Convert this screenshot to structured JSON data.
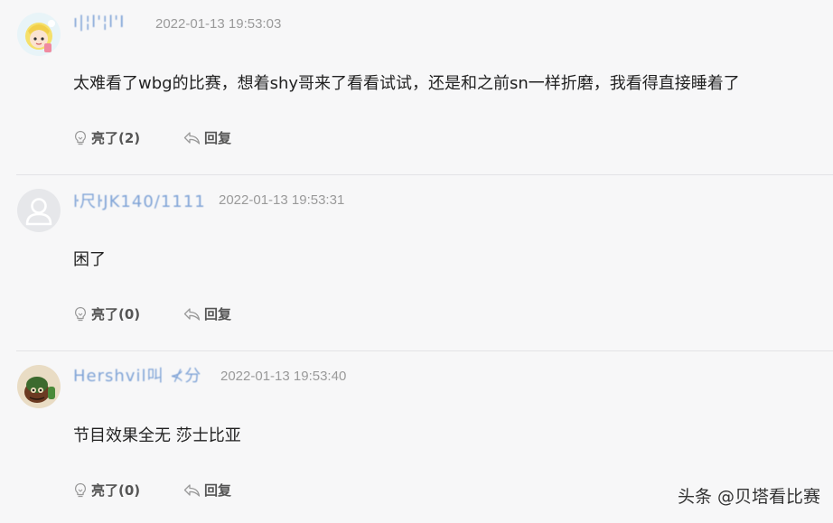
{
  "comments": [
    {
      "username": "ı|¦l'¦l'I",
      "time": "2022-01-13 19:53:03",
      "content": "太难看了wbg的比赛，想着shy哥来了看看试试，还是和之前sn一样折磨，我看得直接睡着了",
      "like_label": "亮了(2)",
      "reply_label": "回复"
    },
    {
      "username": "ŀ尺ŀJK140/1111",
      "time": "2022-01-13 19:53:31",
      "content": "困了",
      "like_label": "亮了(0)",
      "reply_label": "回复"
    },
    {
      "username": "Hershvil叫  ⊀分",
      "time": "2022-01-13 19:53:40",
      "content": "节目效果全无  莎士比亚",
      "like_label": "亮了(0)",
      "reply_label": "回复"
    }
  ],
  "watermark": "头条 @贝塔看比赛"
}
